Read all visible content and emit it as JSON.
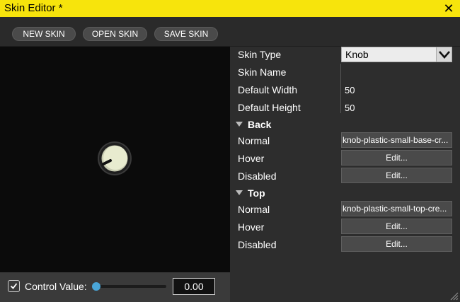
{
  "window": {
    "title": "Skin Editor *",
    "close_glyph": "✕"
  },
  "toolbar": {
    "new_label": "NEW SKIN",
    "open_label": "OPEN SKIN",
    "save_label": "SAVE SKIN"
  },
  "control": {
    "checkbox_checked": true,
    "label": "Control Value:",
    "value_text": "0.00",
    "slider_fraction": 0.0
  },
  "properties": {
    "skin_type_label": "Skin Type",
    "skin_type_value": "Knob",
    "skin_name_label": "Skin Name",
    "skin_name_value": "",
    "width_label": "Default Width",
    "width_value": "50",
    "height_label": "Default Height",
    "height_value": "50"
  },
  "back": {
    "header": "Back",
    "normal_label": "Normal",
    "normal_value": "knob-plastic-small-base-cr...",
    "hover_label": "Hover",
    "hover_button": "Edit...",
    "disabled_label": "Disabled",
    "disabled_button": "Edit..."
  },
  "top": {
    "header": "Top",
    "normal_label": "Normal",
    "normal_value": "knob-plastic-small-top-cre...",
    "hover_label": "Hover",
    "hover_button": "Edit...",
    "disabled_label": "Disabled",
    "disabled_button": "Edit..."
  },
  "colors": {
    "titlebar": "#f7e40c",
    "accent": "#4aa6d8",
    "knob_face": "#e8ebcf"
  },
  "icons": {
    "close": "close-icon",
    "check": "check-icon",
    "dropdown": "chevron-down-icon",
    "collapse": "triangle-down-icon",
    "resize": "resize-grip-icon"
  }
}
